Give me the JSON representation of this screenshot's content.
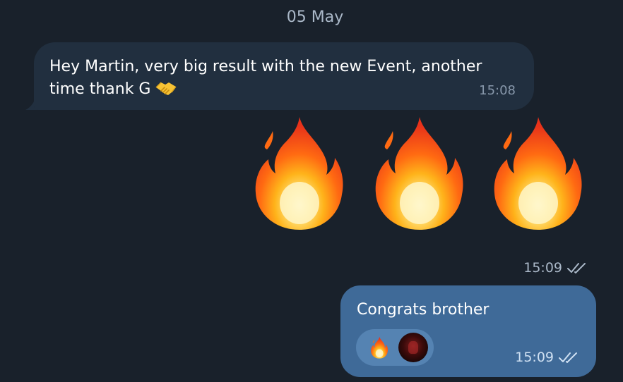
{
  "chat": {
    "date_separator": "05 May",
    "incoming_message": {
      "line1": "Hey Martin, very big result with the new Event, another",
      "line2": "time thank G",
      "emoji": "handshake",
      "time": "15:08"
    },
    "sticker_message": {
      "content": [
        "fire",
        "fire",
        "fire"
      ],
      "time": "15:09",
      "status": "read-double-check"
    },
    "outgoing_message": {
      "text": "Congrats brother",
      "time": "15:09",
      "status": "read-double-check",
      "reactions": {
        "emoji": "fire",
        "reactor": "avatar"
      }
    }
  },
  "colors": {
    "background": "#19212b",
    "incoming_bubble": "#212f3f",
    "outgoing_bubble": "#3f6a98",
    "meta_text": "#8797aa"
  }
}
